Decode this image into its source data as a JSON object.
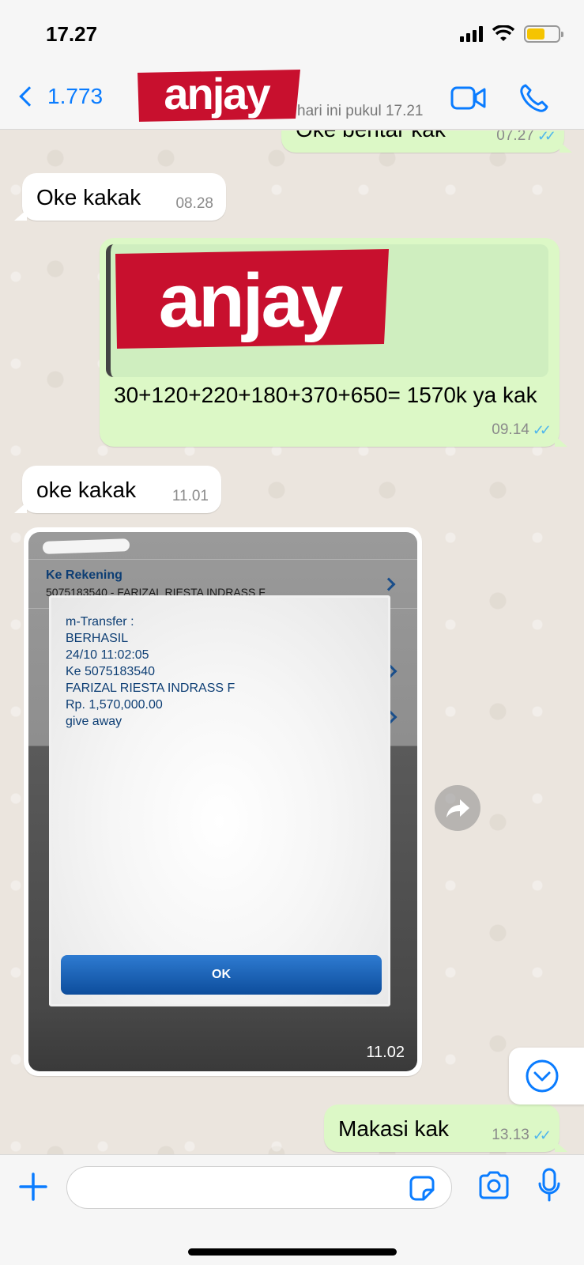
{
  "status_bar": {
    "time": "17.27"
  },
  "header": {
    "back_count": "1.773",
    "contact_logo_text": "anjay",
    "last_seen": "hari ini pukul 17.21"
  },
  "messages": [
    {
      "dir": "out",
      "text": "Oke bentar kak",
      "time": "07.27"
    },
    {
      "dir": "in",
      "text": "Oke kakak",
      "time": "08.28"
    },
    {
      "dir": "out",
      "quote_logo_text": "anjay",
      "text": "30+120+220+180+370+650= 1570k ya kak",
      "time": "09.14"
    },
    {
      "dir": "in",
      "text": "oke kakak",
      "time": "11.01"
    },
    {
      "dir": "in",
      "type": "image",
      "time": "11.02",
      "image": {
        "ke_rekening_label": "Ke Rekening",
        "ke_rekening_value": "5075183540 - FARIZAL RIESTA INDRASS F",
        "dialog_lines": [
          "m-Transfer :",
          "BERHASIL",
          "24/10 11:02:05",
          "Ke 5075183540",
          "FARIZAL RIESTA INDRASS F",
          "Rp. 1,570,000.00",
          "give away"
        ],
        "ok_label": "OK"
      }
    },
    {
      "dir": "out",
      "text": "Makasi kak",
      "time": "13.13"
    }
  ],
  "colors": {
    "accent": "#0a7cff",
    "outgoing_bubble": "#dcf8c6",
    "incoming_bubble": "#ffffff",
    "read_tick": "#4fb6ec",
    "logo_red": "#c8102e"
  },
  "icons": [
    "back-chevron-icon",
    "video-call-icon",
    "phone-icon",
    "forward-icon",
    "scroll-down-icon",
    "plus-icon",
    "sticker-icon",
    "camera-icon",
    "mic-icon"
  ]
}
